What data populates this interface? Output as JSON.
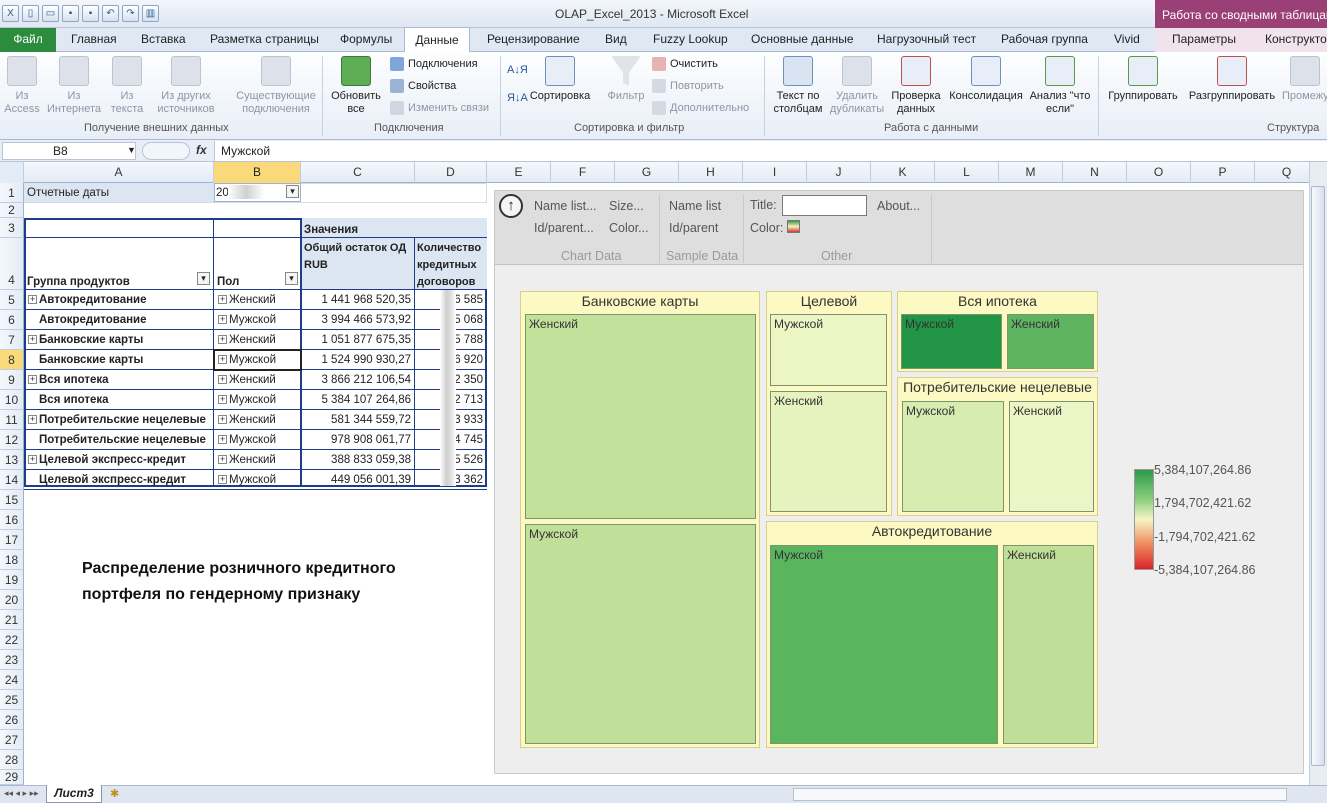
{
  "window": {
    "title": "OLAP_Excel_2013 - Microsoft Excel",
    "contextual": "Работа со сводными таблицами"
  },
  "tabs": [
    "Главная",
    "Вставка",
    "Разметка страницы",
    "Формулы",
    "Данные",
    "Рецензирование",
    "Вид",
    "Fuzzy Lookup",
    "Основные данные",
    "Нагрузочный тест",
    "Рабочая группа",
    "Vivid",
    "Параметры",
    "Конструктор"
  ],
  "file_tab": "Файл",
  "ribbon": {
    "from_access": "Из Access",
    "from_web": "Из Интернета",
    "from_text": "Из текста",
    "from_other": "Из других источников",
    "existing": "Существующие подключения",
    "g_external": "Получение внешних данных",
    "refresh": "Обновить все",
    "connections": "Подключения",
    "properties": "Свойства",
    "edit_links": "Изменить связи",
    "g_connections": "Подключения",
    "sort": "Сортировка",
    "filter": "Фильтр",
    "clear": "Очистить",
    "reapply": "Повторить",
    "advanced": "Дополнительно",
    "g_sort": "Сортировка и фильтр",
    "text_to_cols": "Текст по столбцам",
    "remove_dup": "Удалить дубликаты",
    "validation": "Проверка данных",
    "consolidate": "Консолидация",
    "whatif": "Анализ \"что если\"",
    "g_datatools": "Работа с данными",
    "group": "Группировать",
    "ungroup": "Разгруппировать",
    "subtotal": "Промежуточный итог",
    "g_outline": "Структура"
  },
  "formula_bar": {
    "namebox": "B8",
    "fx": "fx",
    "value": "Мужской"
  },
  "columns": [
    "A",
    "B",
    "C",
    "D",
    "E",
    "F",
    "G",
    "H",
    "I",
    "J",
    "K",
    "L",
    "M",
    "N",
    "O",
    "P",
    "Q"
  ],
  "rows": [
    "1",
    "2",
    "3",
    "4",
    "5",
    "6",
    "7",
    "8",
    "9",
    "10",
    "11",
    "12",
    "13",
    "14",
    "15",
    "16",
    "17",
    "18",
    "19",
    "20",
    "21",
    "22",
    "23",
    "24",
    "25",
    "26",
    "27",
    "28",
    "29"
  ],
  "pivot": {
    "filter_label": "Отчетные даты",
    "filter_value": "20",
    "values_label": "Значения",
    "h_group": "Группа продуктов",
    "h_gender": "Пол",
    "h_balance": "Общий остаток ОД RUB",
    "h_count": "Количество кредитных договоров",
    "rows": [
      {
        "product": "Автокредитование",
        "gender": "Женский",
        "balance": "1 441 968 520,35",
        "count": "6 585",
        "plus": true
      },
      {
        "product": "Автокредитование",
        "gender": "Мужской",
        "balance": "3 994 466 573,92",
        "count": "5 068",
        "plus": false
      },
      {
        "product": "Банковские карты",
        "gender": "Женский",
        "balance": "1 051 877 675,35",
        "count": "5 788",
        "plus": true
      },
      {
        "product": "Банковские карты",
        "gender": "Мужской",
        "balance": "1 524 990 930,27",
        "count": "6 920",
        "plus": false
      },
      {
        "product": "Вся ипотека",
        "gender": "Женский",
        "balance": "3 866 212 106,54",
        "count": "2 350",
        "plus": true
      },
      {
        "product": "Вся ипотека",
        "gender": "Мужской",
        "balance": "5 384 107 264,86",
        "count": "2 713",
        "plus": false
      },
      {
        "product": "Потребительские нецелевые",
        "gender": "Женский",
        "balance": "581 344 559,72",
        "count": "3 933",
        "plus": true
      },
      {
        "product": "Потребительские нецелевые",
        "gender": "Мужской",
        "balance": "978 908 061,77",
        "count": "4 745",
        "plus": false
      },
      {
        "product": "Целевой экспресс-кредит",
        "gender": "Женский",
        "balance": "388 833 059,38",
        "count": "5 526",
        "plus": true
      },
      {
        "product": "Целевой экспресс-кредит",
        "gender": "Мужской",
        "balance": "449 056 001,39",
        "count": "3 362",
        "plus": false
      }
    ]
  },
  "caption": [
    "Распределение розничного кредитного",
    "портфеля по гендерному признаку"
  ],
  "treemap_toolbar": {
    "name_list_dots": "Name list...",
    "size_dots": "Size...",
    "id_parent_dots": "Id/parent...",
    "color_dots": "Color...",
    "chart_data": "Chart Data",
    "name_list": "Name list",
    "id_parent": "Id/parent",
    "sample_data": "Sample Data",
    "title": "Title:",
    "color": "Color:",
    "about": "About...",
    "other": "Other"
  },
  "treemap": {
    "groups": {
      "cards": {
        "title": "Банковские карты",
        "female": "Женский",
        "male": "Мужской"
      },
      "target": {
        "title": "Целевой",
        "male": "Мужской",
        "female": "Женский"
      },
      "mortgage": {
        "title": "Вся ипотека",
        "male": "Мужской",
        "female": "Женский"
      },
      "consumer": {
        "title": "Потребительские нецелевые",
        "male": "Мужской",
        "female": "Женский"
      },
      "auto": {
        "title": "Автокредитование",
        "male": "Мужской",
        "female": "Женский"
      }
    },
    "colors": {
      "cards_female": "#c2e29c",
      "cards_male": "#c0e099",
      "target_male": "#ecf5c4",
      "target_female": "#e7f3be",
      "mortgage_male": "#229445",
      "mortgage_female": "#5eb461",
      "consumer_male": "#d6ecb1",
      "consumer_female": "#ecf5c5",
      "auto_male": "#5ab55f",
      "auto_female": "#bfdf98"
    },
    "legend": [
      "5,384,107,264.86",
      "1,794,702,421.62",
      "-1,794,702,421.62",
      "-5,384,107,264.86"
    ]
  },
  "sheet_tab": "Лист3"
}
